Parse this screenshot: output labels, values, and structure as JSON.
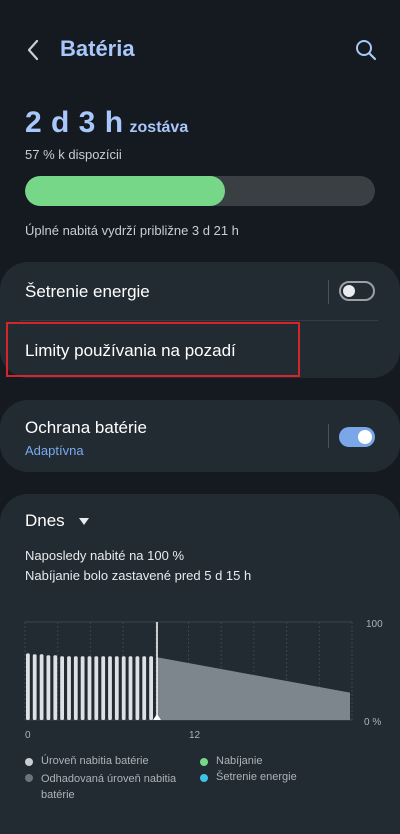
{
  "header": {
    "title": "Batéria"
  },
  "summary": {
    "remaining_time": "2 d 3 h",
    "remaining_suffix": "zostáva",
    "available": "57 % k dispozícii",
    "charge_level": 0.57,
    "full_charge_note": "Úplné nabitá vydrží približne 3 d 21 h"
  },
  "settings": {
    "power_saving_label": "Šetrenie energie",
    "power_saving_on": false,
    "background_limits_label": "Limity používania na pozadí",
    "battery_protection_label": "Ochrana batérie",
    "battery_protection_value": "Adaptívna",
    "battery_protection_on": true
  },
  "usage": {
    "period_label": "Dnes",
    "last_charged": "Naposledy nabité na 100 %",
    "charging_stopped": "Nabíjanie bolo zastavené pred 5 d 15 h"
  },
  "chart_data": {
    "type": "bar",
    "y_tick_labels": [
      "100",
      "0 %"
    ],
    "x_tick_labels": [
      "0",
      "12"
    ],
    "ylim": [
      0,
      100
    ],
    "bars": [
      68,
      67,
      67,
      66,
      66,
      65,
      65,
      65,
      65,
      65,
      65,
      65,
      65,
      65,
      65,
      65,
      65,
      65,
      65
    ],
    "estimated_start": 64,
    "estimated_end": 28,
    "colors": {
      "battery_level": "#dde1e5",
      "estimated": "#7d858d",
      "charging": "#77d789",
      "power_saving": "#3dc4e6"
    },
    "legend": [
      {
        "label": "Úroveň nabitia batérie",
        "color": "#c9ced3"
      },
      {
        "label": "Nabíjanie",
        "color": "#77d789"
      },
      {
        "label": "Odhadovaná úroveň nabitia batérie",
        "color": "#6c737a"
      },
      {
        "label": "Šetrenie energie",
        "color": "#3dc4e6"
      }
    ]
  }
}
